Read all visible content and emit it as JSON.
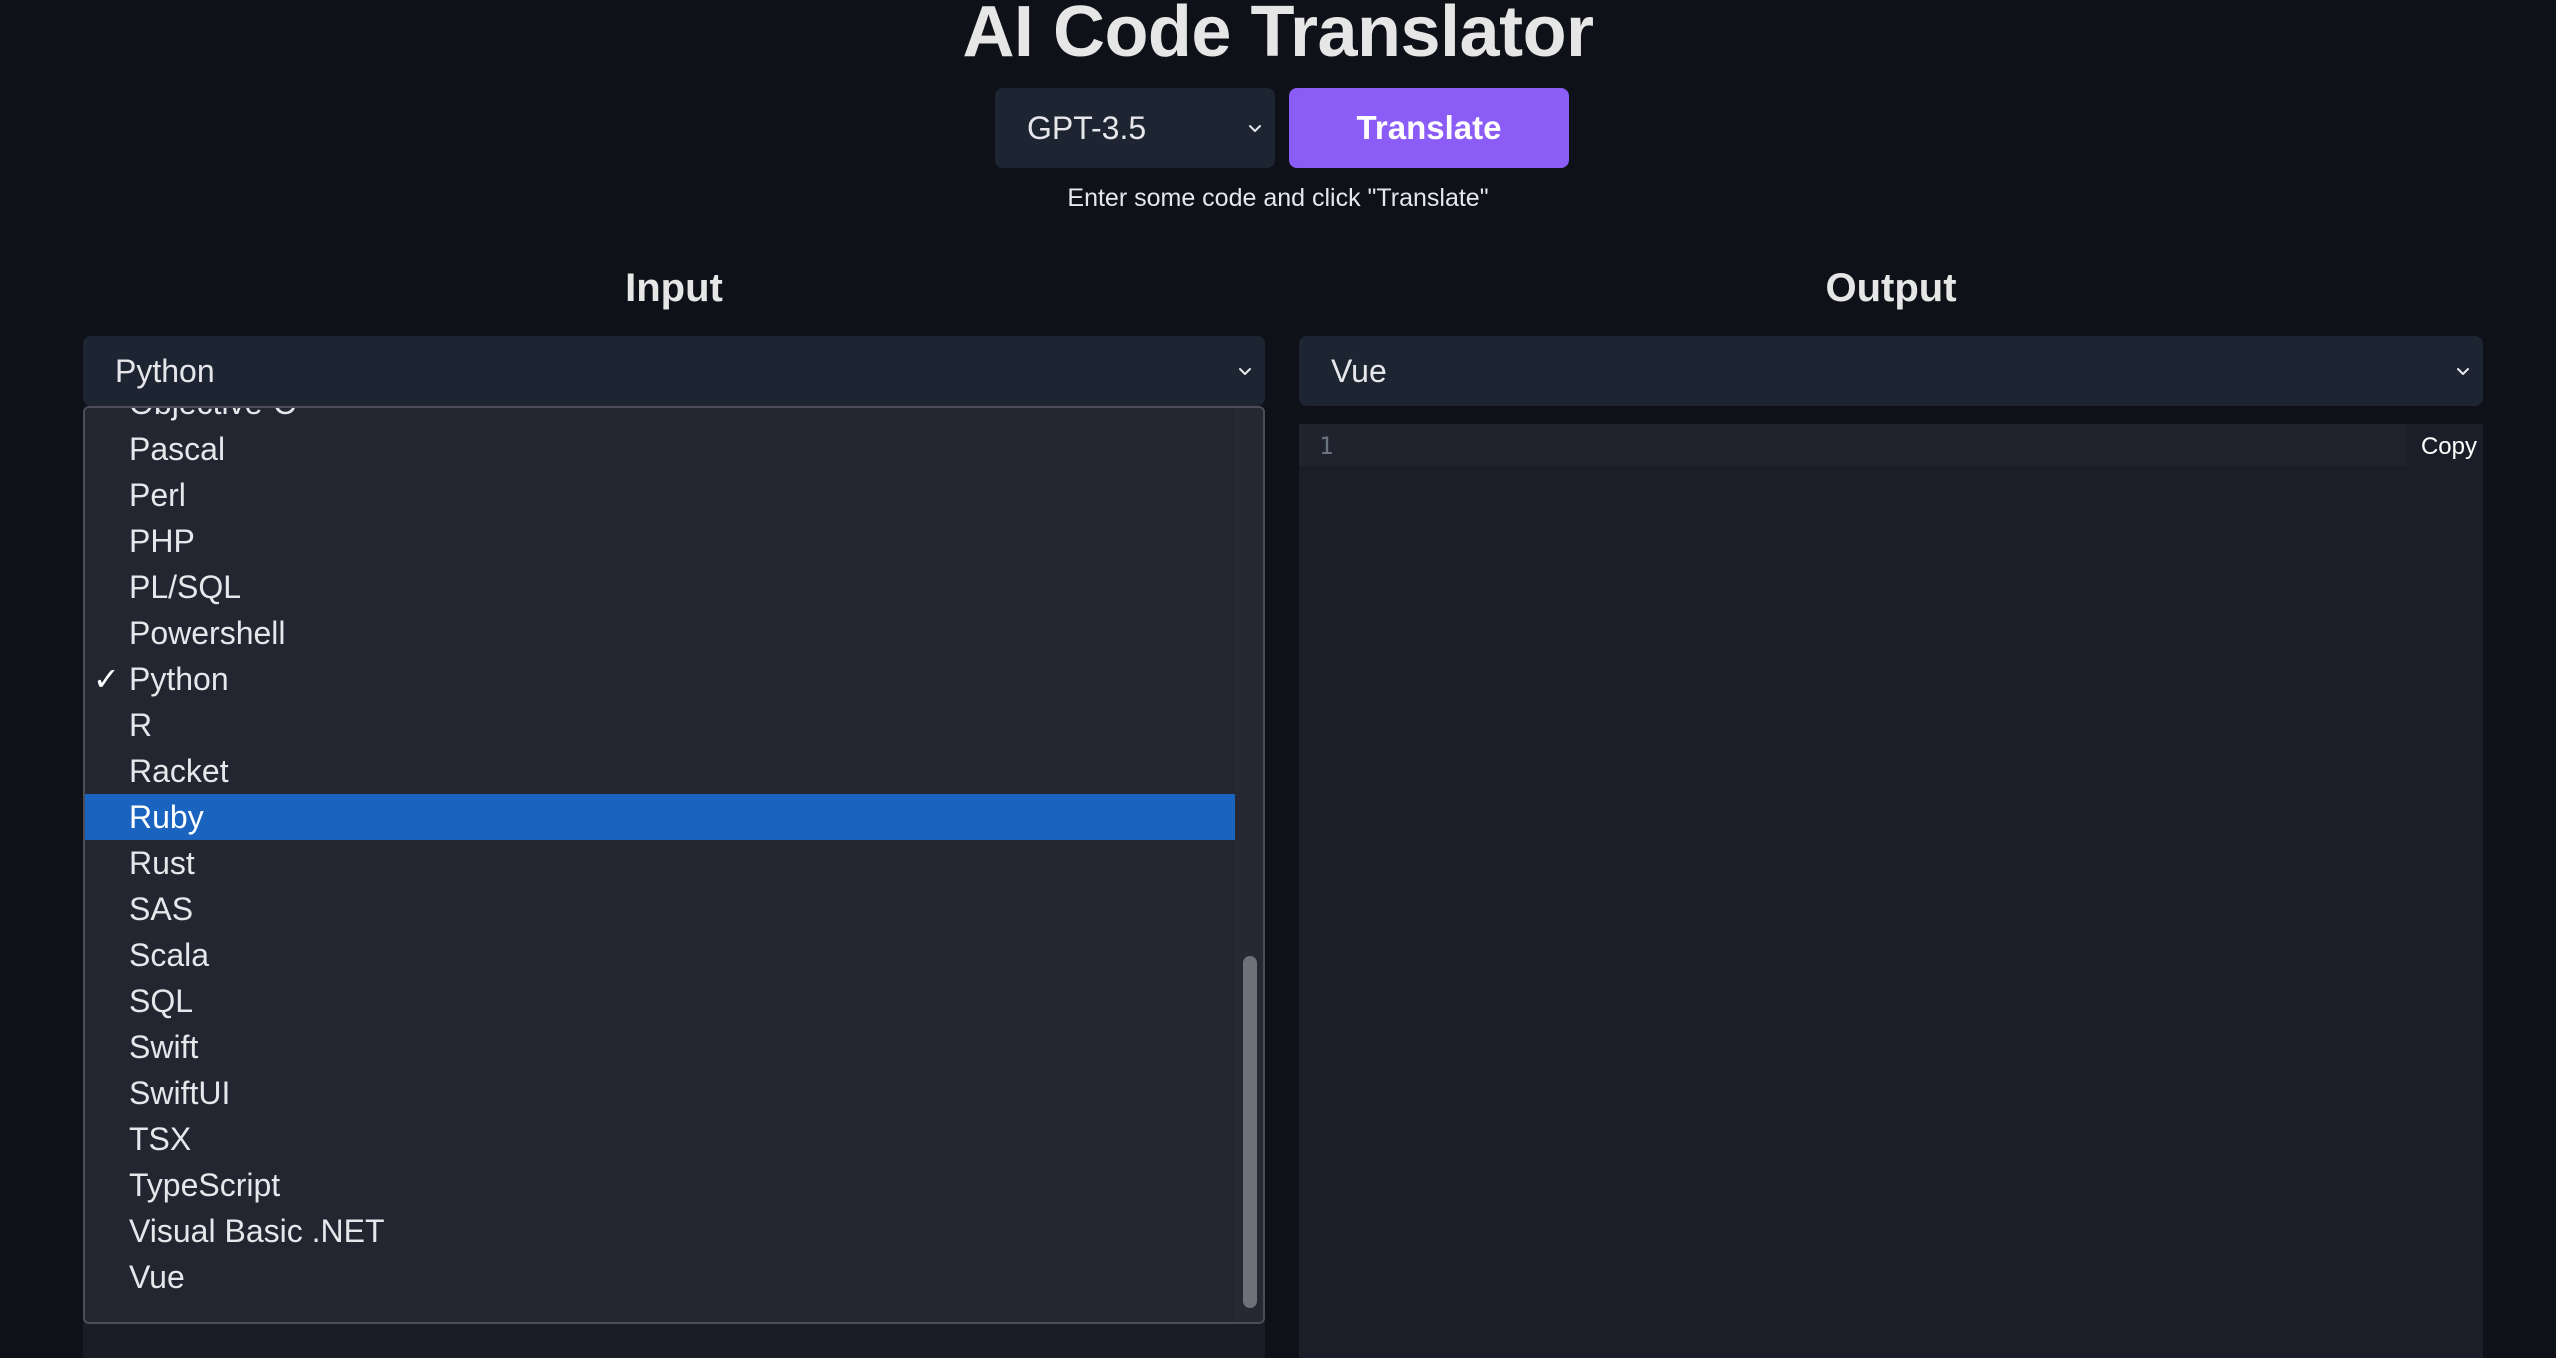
{
  "app": {
    "title": "AI Code Translator",
    "hint": "Enter some code and click \"Translate\""
  },
  "controls": {
    "model_selected": "GPT-3.5",
    "translate_label": "Translate"
  },
  "input": {
    "heading": "Input",
    "language_selected": "Python",
    "dropdown": {
      "options": [
        "Objective-C",
        "Pascal",
        "Perl",
        "PHP",
        "PL/SQL",
        "Powershell",
        "Python",
        "R",
        "Racket",
        "Ruby",
        "Rust",
        "SAS",
        "Scala",
        "SQL",
        "Swift",
        "SwiftUI",
        "TSX",
        "TypeScript",
        "Visual Basic .NET",
        "Vue"
      ],
      "checked": "Python",
      "highlighted": "Ruby",
      "check_glyph": "✓"
    }
  },
  "output": {
    "heading": "Output",
    "language_selected": "Vue",
    "line_number": "1",
    "copy_label": "Copy"
  },
  "colors": {
    "background": "#0f1118",
    "accent": "#8b5cf6",
    "highlight": "#1a64c0",
    "select_bg": "#1e2532"
  }
}
